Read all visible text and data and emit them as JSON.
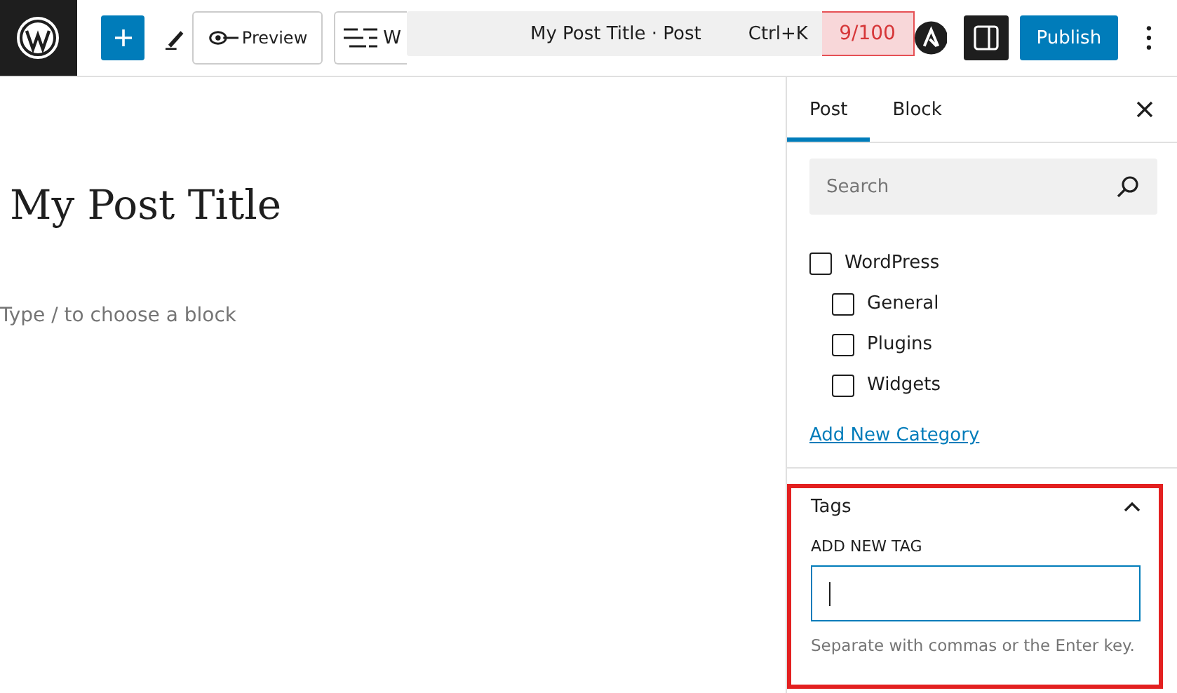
{
  "toolbar": {
    "preview_label": "Preview",
    "view_label": "W",
    "command_bar": {
      "title": "My Post Title · Post",
      "shortcut": "Ctrl+K"
    },
    "score": "9/100",
    "publish_label": "Publish"
  },
  "editor": {
    "title": "My Post Title",
    "block_placeholder": "Type / to choose a block"
  },
  "sidebar": {
    "tabs": [
      {
        "label": "Post",
        "selected": true
      },
      {
        "label": "Block",
        "selected": false
      }
    ],
    "search": {
      "placeholder": "Search"
    },
    "categories": [
      {
        "label": "WordPress",
        "checked": false,
        "children": [
          {
            "label": "General",
            "checked": false
          },
          {
            "label": "Plugins",
            "checked": false
          },
          {
            "label": "Widgets",
            "checked": false
          }
        ]
      }
    ],
    "add_category_link": "Add New Category",
    "tags_panel": {
      "title": "Tags",
      "expanded": true,
      "highlighted": true,
      "field_label": "ADD NEW TAG",
      "help": "Separate with commas or the Enter key."
    }
  }
}
